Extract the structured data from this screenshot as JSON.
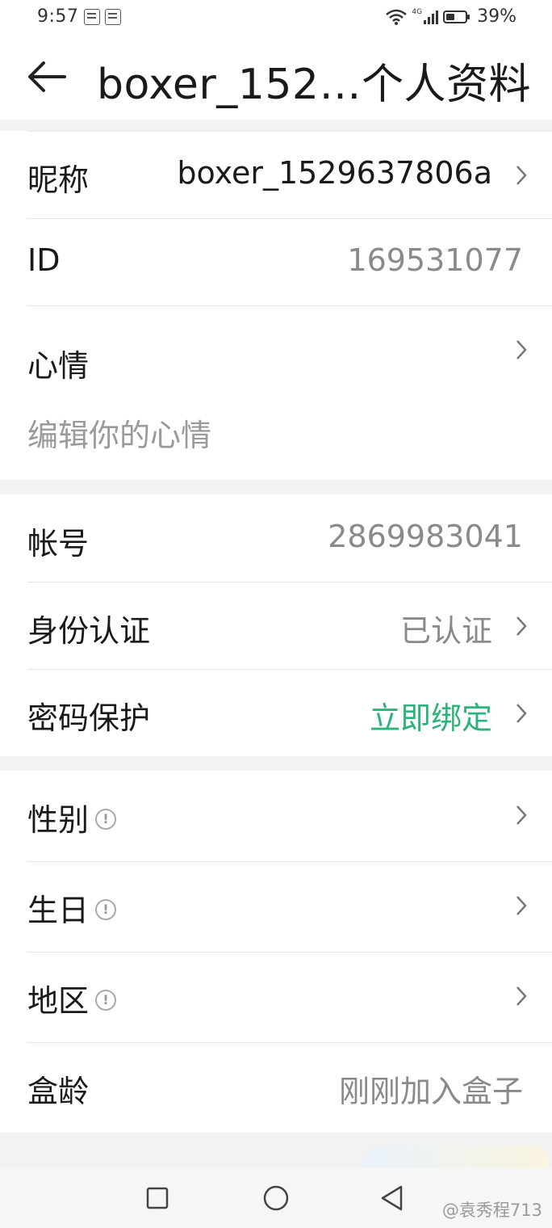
{
  "status_bar": {
    "time": "9:57",
    "network": "4G",
    "battery": "39%"
  },
  "header": {
    "title": "boxer_152…个人资料"
  },
  "profile": {
    "nickname_label": "昵称",
    "nickname_value": "boxer_1529637806a",
    "id_label": "ID",
    "id_value": "169531077",
    "mood_label": "心情",
    "mood_placeholder": "编辑你的心情"
  },
  "account": {
    "account_label": "帐号",
    "account_value": "2869983041",
    "identity_label": "身份认证",
    "identity_value": "已认证",
    "password_label": "密码保护",
    "password_value": "立即绑定"
  },
  "details": {
    "gender_label": "性别",
    "birthday_label": "生日",
    "region_label": "地区",
    "box_age_label": "盒龄",
    "box_age_value": "刚刚加入盒子"
  },
  "watermark": "@袁秀程713",
  "colors": {
    "accent_green": "#2db37a",
    "muted_text": "#8a8a8a",
    "page_bg": "#f2f2f2"
  }
}
